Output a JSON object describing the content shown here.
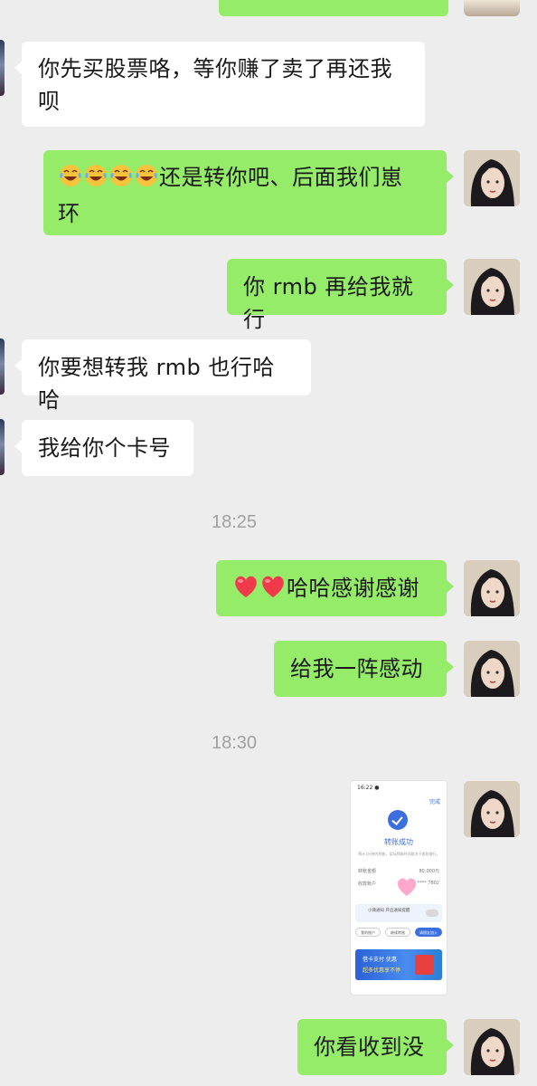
{
  "messages": [
    {
      "side": "in",
      "text_line1": "你先买股票咯，等你赚了卖了再还我",
      "text_line2": "呗"
    },
    {
      "side": "out",
      "emojis": [
        "tears-of-joy",
        "tears-of-joy",
        "tears-of-joy",
        "tears-of-joy"
      ],
      "text_line1": "还是转你吧、后面我们崽",
      "text_line2": "环"
    },
    {
      "side": "out",
      "text": "你 rmb 再给我就行"
    },
    {
      "side": "in",
      "text": "你要想转我 rmb 也行哈哈"
    },
    {
      "side": "in",
      "text": "我给你个卡号"
    },
    {
      "type": "timestamp",
      "text": "18:25"
    },
    {
      "side": "out",
      "emojis": [
        "red-heart",
        "red-heart"
      ],
      "text": "哈哈感谢感谢"
    },
    {
      "side": "out",
      "text": "给我一阵感动"
    },
    {
      "type": "timestamp",
      "text": "18:30"
    },
    {
      "side": "out",
      "type": "image",
      "image": {
        "status_time": "16:22 ●",
        "done": "完成",
        "title": "转账成功",
        "subtitle": "预计1分钟内到账，实际到账时间取决于收款银行。",
        "amount_label": "转账金额",
        "amount_value": "80,000元",
        "account_label": "收款账户",
        "account_value": "**** 7802",
        "card_text": "小微通知 开启通知提醒",
        "btn1": "我的账户",
        "btn2": "继续转账",
        "btn3": "请朋友加入",
        "banner_line1": "借卡支付 优惠",
        "banner_line2": "超多优惠享不停"
      }
    },
    {
      "side": "out",
      "text": "你看收到没"
    }
  ],
  "colors": {
    "background": "#ededed",
    "outgoing_bubble": "#95ec69",
    "incoming_bubble": "#ffffff",
    "timestamp": "#a0a0a0"
  }
}
